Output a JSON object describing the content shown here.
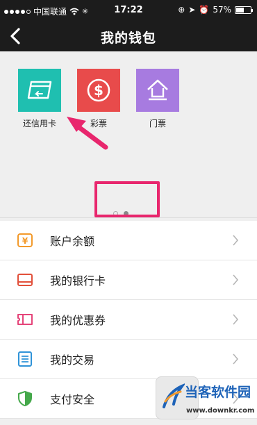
{
  "status_bar": {
    "carrier": "中国联通",
    "time": "17:22",
    "battery": "57%",
    "battery_level": 0.57
  },
  "nav": {
    "title": "我的钱包",
    "back_icon": "chevron-left-icon"
  },
  "tiles": [
    {
      "label": "还信用卡",
      "icon": "credit-card-repay-icon",
      "color": "#1fbfb0"
    },
    {
      "label": "彩票",
      "icon": "dollar-coin-icon",
      "color": "#e84b4b"
    },
    {
      "label": "门票",
      "icon": "house-ticket-icon",
      "color": "#a77be0"
    }
  ],
  "pager": {
    "pages": 2,
    "active": 2
  },
  "menu": [
    {
      "label": "账户余额",
      "icon": "yen-balance-icon",
      "color": "#f39a2b"
    },
    {
      "label": "我的银行卡",
      "icon": "bank-card-icon",
      "color": "#e2503a"
    },
    {
      "label": "我的优惠券",
      "icon": "coupon-icon",
      "color": "#e5457a"
    },
    {
      "label": "我的交易",
      "icon": "transaction-list-icon",
      "color": "#2f93d8"
    },
    {
      "label": "支付安全",
      "icon": "shield-icon",
      "color": "#44a84a"
    }
  ],
  "watermark": {
    "name": "当客软件园",
    "url": "www.downkr.com"
  },
  "colors": {
    "highlight": "#e8266d",
    "nav_bg": "#1c1c1c"
  }
}
